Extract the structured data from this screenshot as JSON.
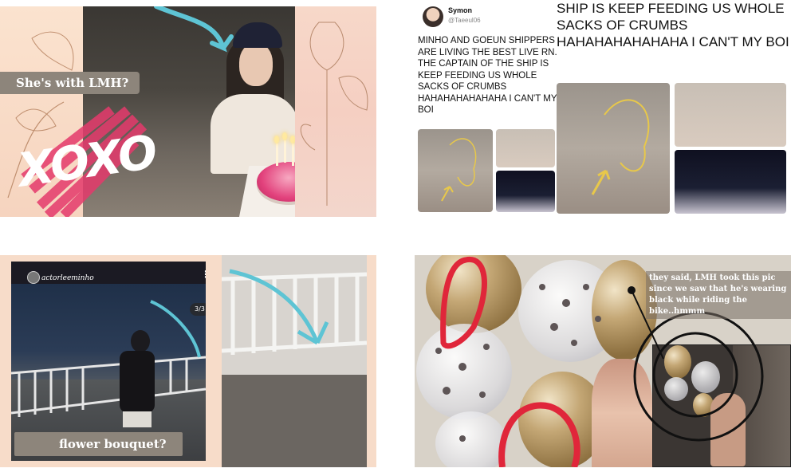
{
  "panel1": {
    "label": "She's with LMH?",
    "overlay_text": "XOXO"
  },
  "panel2": {
    "username": "Symon",
    "handle": "@Taeeul06",
    "tweet": "MINHO AND GOEUN SHIPPERS ARE LIVING THE BEST LIVE RN. THE CAPTAIN OF THE SHIP IS KEEP FEEDING US WHOLE SACKS OF CRUMBS HAHAHAHAHAHAHA I CAN'T MY BOI",
    "tweet_zoom": "SHIP IS KEEP FEEDING US WHOLE SACKS OF CRUMBS HAHAHAHAHAHAHA I CAN'T MY BOI"
  },
  "panel3": {
    "account": "actorleeminho",
    "counter": "3/3",
    "label": "flower bouquet?"
  },
  "panel4": {
    "note": "they said, LMH took this pic since we saw that he's wearing black while riding the bike..hmmm"
  },
  "colors": {
    "label_bg": "#8d857b",
    "peach": "#f7dcc9",
    "pink_scribble": "#e53a6c",
    "teal_arrow": "#5ec4d4",
    "red_circle": "#e0263a"
  }
}
